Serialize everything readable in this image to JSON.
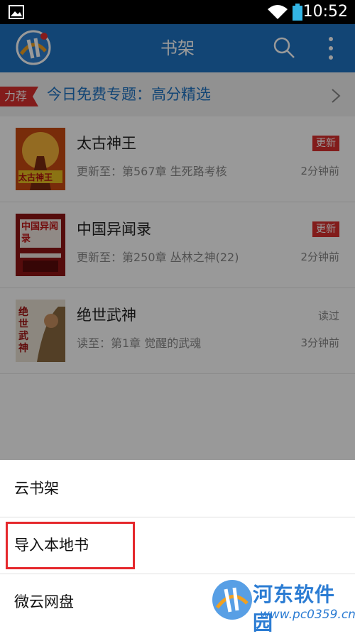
{
  "status_bar": {
    "time": "10:52",
    "icons": [
      "gallery-icon",
      "wifi-icon",
      "battery-icon"
    ]
  },
  "app_bar": {
    "title": "书架",
    "icons": [
      "app-logo",
      "search-icon",
      "more-vertical-icon"
    ]
  },
  "promo": {
    "badge": "力荐",
    "text": "今日免费专题：高分精选",
    "icon": "chevron-right-icon"
  },
  "books": [
    {
      "title": "太古神王",
      "progress": "更新至：第567章 生死路考核",
      "badge": "更新",
      "time": "2分钟前",
      "cover_text": "太古神王"
    },
    {
      "title": "中国异闻录",
      "progress": "更新至：第250章 丛林之神(22)",
      "badge": "更新",
      "time": "2分钟前",
      "cover_text": "中国异闻录"
    },
    {
      "title": "绝世武神",
      "progress": "读至：第1章 觉醒的武魂",
      "read_state": "读过",
      "time": "3分钟前",
      "cover_text": "绝世武神"
    }
  ],
  "sheet": {
    "items": [
      "云书架",
      "导入本地书",
      "微云网盘"
    ],
    "highlighted_index": 1
  },
  "watermark": {
    "name": "河东软件园",
    "url": "www.pc0359.cn"
  },
  "colors": {
    "accent": "#1f73c4",
    "badge": "#d9302e",
    "highlight": "#e5282c"
  }
}
